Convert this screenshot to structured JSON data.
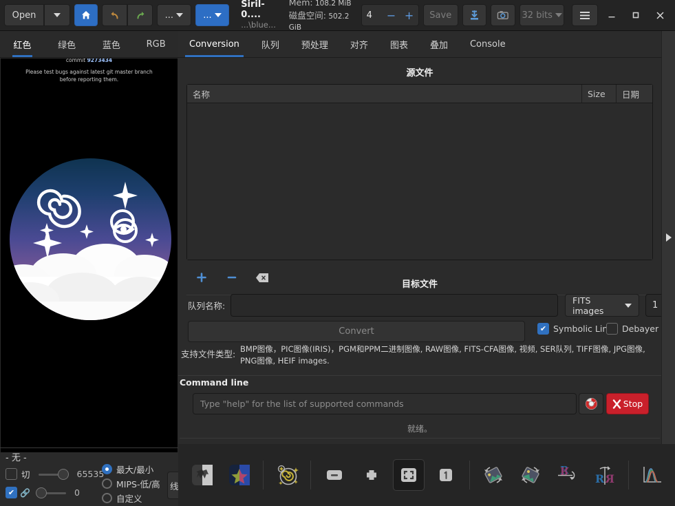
{
  "titlebar": {
    "open_label": "Open",
    "open_dropdown_icon": "chevron-down-icon",
    "home_icon": "home-icon",
    "undo_icon": "undo-arrow-icon",
    "redo_icon": "redo-arrow-icon",
    "ellipsis_label": "...",
    "ellipsis2_label": "...",
    "title": "Siril-0....",
    "subtitle": "...\\blue...",
    "mem_label": "Mem:",
    "mem_value": "108.2 MiB",
    "disk_label": "磁盘空间:",
    "disk_value": "502.2 GiB",
    "zoom_value": "4",
    "minus_label": "−",
    "plus_label": "+",
    "save_label": "Save",
    "save_as_icon": "save-as-icon",
    "snapshot_icon": "camera-snapshot-icon",
    "bitdepth_label": "32 bits",
    "hamburger_icon": "hamburger-menu-icon",
    "minimize_icon": "minimize-icon",
    "maximize_icon": "maximize-icon",
    "close_icon": "close-icon"
  },
  "left_panel": {
    "tabs": [
      {
        "label": "红色",
        "active": true
      },
      {
        "label": "绿色",
        "active": false
      },
      {
        "label": "蓝色",
        "active": false
      },
      {
        "label": "RGB",
        "active": false
      }
    ],
    "preview": {
      "commit_prefix": "commit ",
      "commit_hash": "9273434",
      "notice_line1": "Please test bugs against latest git master branch",
      "notice_line2": "before reporting them."
    },
    "selection_label": "- 无 -",
    "controls": {
      "cut_label": "切",
      "high_value": "65535",
      "low_value": "0",
      "link_icon": "link-chain-icon",
      "radios": [
        {
          "label": "最大/最小",
          "selected": true
        },
        {
          "label": "MIPS-低/高",
          "selected": false
        },
        {
          "label": "自定义",
          "selected": false
        }
      ],
      "display_mode": "线性"
    }
  },
  "main": {
    "tabs": [
      {
        "label": "Conversion",
        "active": true
      },
      {
        "label": "队列",
        "active": false
      },
      {
        "label": "预处理",
        "active": false
      },
      {
        "label": "对齐",
        "active": false
      },
      {
        "label": "图表",
        "active": false
      },
      {
        "label": "叠加",
        "active": false
      },
      {
        "label": "Console",
        "active": false
      }
    ],
    "source_files": {
      "title": "源文件",
      "columns": [
        "名称",
        "Size",
        "日期"
      ],
      "rows": [],
      "add_icon": "plus-icon",
      "remove_icon": "minus-icon",
      "clear_icon": "clear-all-icon"
    },
    "target_files": {
      "title": "目标文件",
      "sequence_name_label": "队列名称:",
      "sequence_name_value": "",
      "sequence_name_placeholder": "",
      "output_format": "FITS images",
      "start_index": "1",
      "convert_label": "Convert",
      "symbolic_link_label": "Symbolic Link",
      "symbolic_link_checked": true,
      "debayer_label": "Debayer",
      "debayer_checked": false,
      "supported_label": "支持文件类型:",
      "supported_value": "BMP图像，PIC图像(IRIS)，PGM和PPM二进制图像, RAW图像, FITS-CFA图像, 视频, SER队列, TIFF图像, JPG图像, PNG图像, HEIF images."
    },
    "command_line": {
      "title": "Command line",
      "placeholder": "Type \"help\" for the list of supported commands",
      "value": "",
      "help_icon": "lifebuoy-help-icon",
      "stop_label": "Stop",
      "stop_icon": "x-cross-icon",
      "status": "就绪。"
    },
    "panel_handle_icon": "expand-right-arrow-icon"
  },
  "bottom_toolbar": {
    "buttons": [
      {
        "name": "bw-preview-icon",
        "active": false
      },
      {
        "name": "color-preview-icon",
        "active": false
      },
      {
        "name": "astrometry-annotate-icon",
        "active": false
      },
      {
        "name": "zoom-out-icon",
        "active": false
      },
      {
        "name": "zoom-in-icon",
        "active": false
      },
      {
        "name": "zoom-fit-icon",
        "active": true
      },
      {
        "name": "zoom-one-to-one-icon",
        "active": false
      },
      {
        "name": "rotate-left-icon",
        "active": false
      },
      {
        "name": "rotate-right-icon",
        "active": false
      },
      {
        "name": "flip-vertical-icon",
        "active": false
      },
      {
        "name": "flip-horizontal-icon",
        "active": false
      },
      {
        "name": "histogram-icon",
        "active": false
      },
      {
        "name": "image-stack-icon",
        "active": false
      }
    ]
  },
  "colors": {
    "accent": "#3071c0",
    "window_bg": "#2b2b2b",
    "titlebar_bg": "#242424",
    "danger": "#c9202b"
  }
}
